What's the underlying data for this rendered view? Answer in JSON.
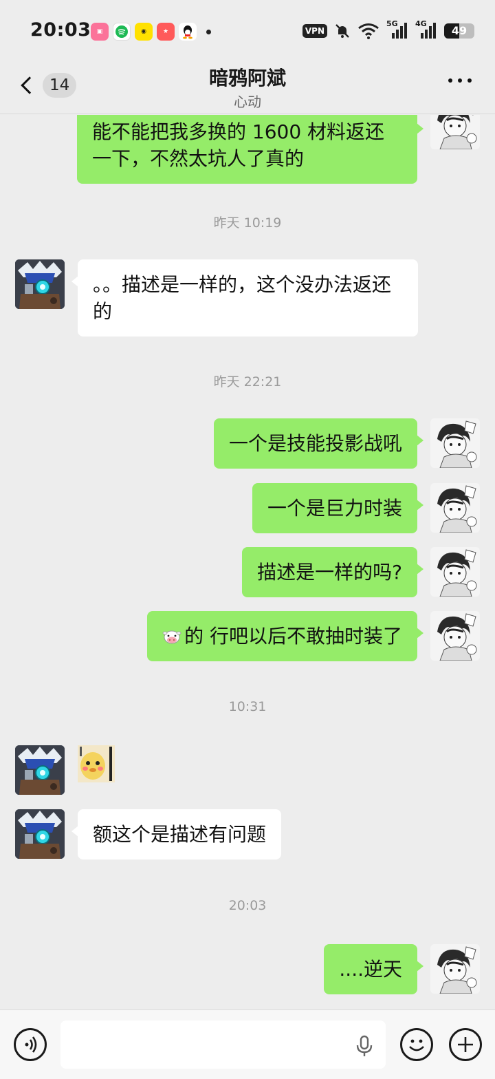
{
  "status_bar": {
    "time": "20:03",
    "vpn": "VPN",
    "battery": "49",
    "battery_level": 0.49,
    "network_1": "5G",
    "network_2": "4G",
    "icons": [
      "bilibili-app-icon",
      "spotify-app-icon",
      "app-icon",
      "app-icon",
      "qq-app-icon",
      "mute-icon",
      "wifi-icon",
      "signal-icon",
      "signal-icon",
      "battery-icon"
    ]
  },
  "header": {
    "back_badge": "14",
    "title": "暗鸦阿斌",
    "subtitle": "心动"
  },
  "messages": {
    "m1": "能不能把我多换的 1600 材料返还一下，不然太坑人了真的",
    "ts1": "昨天 10:19",
    "m2": "。。描述是一样的，这个没办法返还的",
    "ts2": "昨天 22:21",
    "m3": "一个是技能投影战吼",
    "m4": "一个是巨力时装",
    "m5": "描述是一样的吗?",
    "m6": "的 行吧以后不敢抽时装了",
    "ts3": "10:31",
    "m8": "额这个是描述有问题",
    "ts4": "20:03",
    "m9": "....逆天"
  },
  "input": {
    "placeholder": ""
  },
  "colors": {
    "my_bubble": "#95ec69",
    "their_bubble": "#ffffff",
    "background": "#ededed"
  }
}
